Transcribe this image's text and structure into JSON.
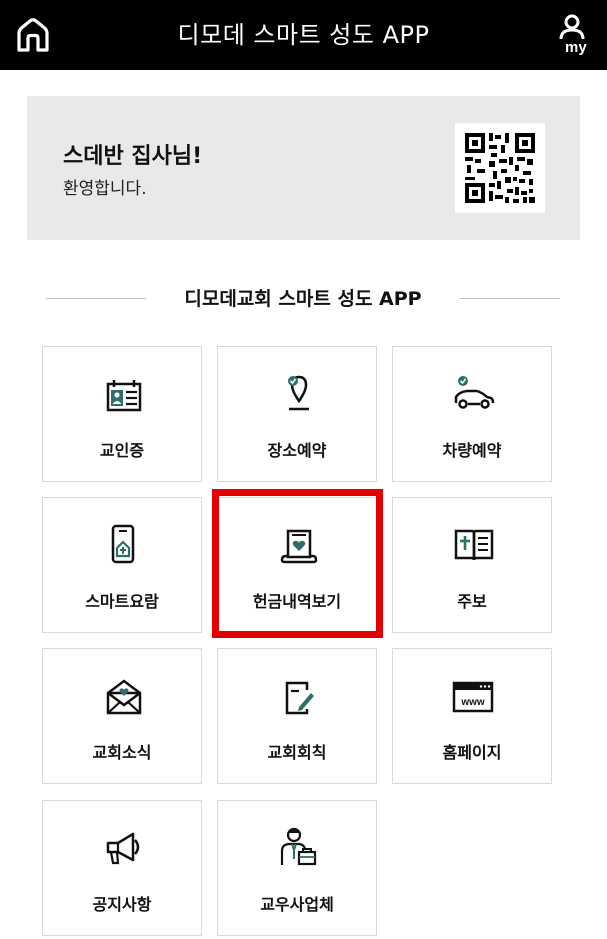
{
  "header": {
    "title": "디모데 스마트 성도 APP",
    "home_icon": "home-icon",
    "my_icon": "my-profile-icon",
    "my_label": "my"
  },
  "welcome": {
    "name": "스데반 집사님!",
    "greeting": "환영합니다.",
    "qr_icon": "qr-code-icon"
  },
  "section": {
    "title": "디모데교회 스마트 성도 APP"
  },
  "menu": [
    {
      "label": "교인증",
      "icon": "id-card-icon"
    },
    {
      "label": "장소예약",
      "icon": "location-pin-icon"
    },
    {
      "label": "차량예약",
      "icon": "car-icon"
    },
    {
      "label": "스마트요람",
      "icon": "smartphone-icon"
    },
    {
      "label": "헌금내역보기",
      "icon": "offering-book-icon"
    },
    {
      "label": "주보",
      "icon": "bulletin-book-icon"
    },
    {
      "label": "교회소식",
      "icon": "mail-icon"
    },
    {
      "label": "교회회칙",
      "icon": "document-pen-icon"
    },
    {
      "label": "홈페이지",
      "icon": "browser-www-icon"
    },
    {
      "label": "공지사항",
      "icon": "megaphone-icon"
    },
    {
      "label": "교우사업체",
      "icon": "business-person-icon"
    }
  ],
  "colors": {
    "accent": "#2f6e6a",
    "header_bg": "#000000",
    "highlight": "#e50000",
    "welcome_bg": "#e9e9e9"
  },
  "selected_item": "헌금내역보기"
}
